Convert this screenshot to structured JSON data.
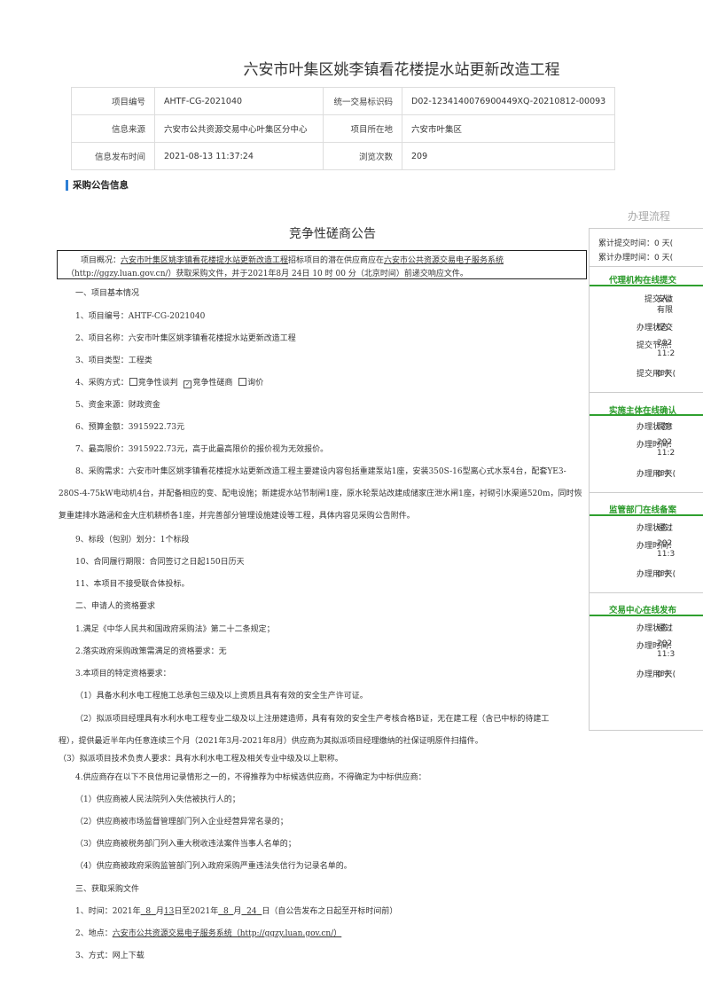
{
  "page_title": "六安市叶集区姚李镇看花楼提水站更新改造工程",
  "info_rows": [
    {
      "l1": "项目编号",
      "v1": "AHTF-CG-2021040",
      "l2": "统一交易标识码",
      "v2": "D02-12341400769004​49XQ-20210812-00093"
    },
    {
      "l1": "信息来源",
      "v1": "六安市公共资源交易中心叶集区分中心",
      "l2": "项目所在地",
      "v2": "六安市叶集区"
    },
    {
      "l1": "信息发布时间",
      "v1": "2021-08-13 11:37:24",
      "l2": "浏览次数",
      "v2": "209"
    }
  ],
  "section_title": "采购公告信息",
  "side": {
    "header": "办理流程",
    "stat1": "累计提交时间：0 天(",
    "stat2": "累计办理时间：0 天(",
    "groups": [
      {
        "title": "代理机构在线提交",
        "rows": [
          {
            "label": "提交人：",
            "value": "安徽",
            "value2": "有限"
          },
          {
            "label": "办理状态：",
            "value": "提交"
          },
          {
            "label": "提交节点：",
            "value": "202",
            "value2": "11:2"
          },
          {
            "label": "提交用时：",
            "value": "0 天("
          }
        ]
      },
      {
        "title": "实施主体在线确认",
        "rows": [
          {
            "label": "办理状态：",
            "value": "同意"
          },
          {
            "label": "办理时间：",
            "value": "202",
            "value2": "11:2"
          },
          {
            "label": "办理用时：",
            "value": "0 天("
          }
        ]
      },
      {
        "title": "监管部门在线备案",
        "rows": [
          {
            "label": "办理状态：",
            "value": "通过"
          },
          {
            "label": "办理时间：",
            "value": "202",
            "value2": "11:3"
          },
          {
            "label": "办理用时：",
            "value": "0 天("
          }
        ]
      },
      {
        "title": "交易中心在线发布",
        "rows": [
          {
            "label": "办理状态：",
            "value": "通过"
          },
          {
            "label": "办理时间：",
            "value": "202",
            "value2": "11:3"
          },
          {
            "label": "办理用时：",
            "value": "0 天("
          }
        ]
      }
    ]
  },
  "doc": {
    "heading": "竞争性磋商公告",
    "box1_a": "项目概况：",
    "box1_b": "六安市叶集区姚李镇看花楼提水站更新改造工程",
    "box1_c": "招标项目的潜在供应商应在",
    "box1_d": "六安市公共资源交易电子服务系统",
    "box2": "（http://ggzy.luan.gov.cn/）获取采购文件，并于2021年8月 24日 10 时 00 分（北京时间）前递交响应文件。",
    "s1": "一、项目基本情况",
    "i1": "1、项目编号：AHTF-CG-2021040",
    "i2": "2、项目名称：六安市叶集区姚李镇看花楼提水站更新改造工程",
    "i3": "3、项目类型：工程类",
    "i4_a": "4、采购方式：",
    "i4_b": "竞争性谈判",
    "i4_c": "竞争性磋商",
    "i4_d": "询价",
    "i5": "5、资金来源：财政资金",
    "i6": "6、预算金额：3915922.73元",
    "i7": "7、最高限价：3915922.73元，高于此最高限价的报价视为无效报价。",
    "i8_1": "8、采购需求：六安市叶集区姚李镇看花楼提水站更新改造工程主要建设内容包括重建泵站1座，安装350S-16型离心式水泵4台，配套YE3-",
    "i8_2": "280S-4-75kW电动机4台，并配备相应的变、配电设施；新建提水站节制闸1座，原水轮泵站改建成储家庄泄水闸1座，衬砌引水渠道520m，同时恢",
    "i8_3": "复重建排水路涵和金大庄机耕桥各1座，并完善部分管理设施建设等工程，具体内容见采购公告附件。",
    "i9": "9、标段（包别）划分：1个标段",
    "i10": "10、合同履行期限：合同签订之日起150日历天",
    "i11": "11、本项目不接受联合体投标。",
    "s2": "二、申请人的资格要求",
    "q1": "1.满足《中华人民共和国政府采购法》第二十二条规定；",
    "q2": "2.落实政府采购政策需满足的资格要求：无",
    "q3": "3.本项目的特定资格要求：",
    "q3a": "（1）具备水利水电工程施工总承包三级及以上资质且具有有效的安全生产许可证。",
    "q3b_1": "（2）拟派项目经理具有水利水电工程专业二级及以上注册建造师，具有有效的安全生产考核合格B证，无在建工程（含已中标的待建工",
    "q3b_2": "程），提供最近半年内任意连续三个月（2021年3月-2021年8月）供应商为其拟派项目经理缴纳的社保证明原件扫描件。",
    "q3c": "（3）拟派项目技术负责人要求：具有水利水电工程及相关专业中级及以上职称。",
    "q4": "4.供应商存在以下不良信用记录情形之一的，不得推荐为中标候选供应商，不得确定为中标供应商：",
    "q4a": "（1）供应商被人民法院列入失信被执行人的；",
    "q4b": "（2）供应商被市场监督管理部门列入企业经营异常名录的；",
    "q4c": "（3）供应商被税务部门列入重大税收违法案件当事人名单的；",
    "q4d": "（4）供应商被政府采购监管部门列入政府采购严重违法失信行为记录名单的。",
    "s3": "三、获取采购文件",
    "g1_a": "1、时间：2021年",
    "g1_b": "8",
    "g1_c": "月",
    "g1_d": "13",
    "g1_e": "日至2021年",
    "g1_f": "8",
    "g1_g": "月",
    "g1_h": "24",
    "g1_i": "日（自公告发布之日起至开标时间前）",
    "g2_a": "2、地点：",
    "g2_b": "六安市公共资源交易电子服务系统（http://ggzy.luan.gov.cn/）",
    "g3": "3、方式：网上下载"
  }
}
